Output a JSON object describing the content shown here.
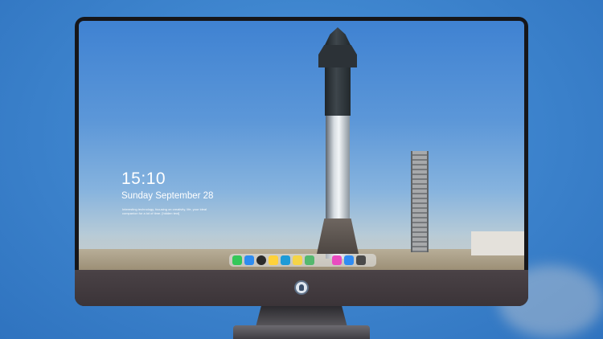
{
  "lock_screen": {
    "time": "15:10",
    "date": "Sunday September 28",
    "note": "Interesting technology, focusing on creativity, life, your ideal companion for a lot of time. [hidden text]"
  },
  "dock": {
    "items": [
      {
        "name": "messages",
        "icon": "message-icon",
        "color": "#34c759",
        "glyph": "💬"
      },
      {
        "name": "files",
        "icon": "folder-icon",
        "color": "#2e8cf0",
        "glyph": "▣"
      },
      {
        "name": "clock",
        "icon": "clock-icon",
        "color": "#2b2b2b",
        "glyph": "◷"
      },
      {
        "name": "photos",
        "icon": "photos-icon",
        "color": "#ffd23a",
        "glyph": "✿"
      },
      {
        "name": "videos",
        "icon": "clapper-icon",
        "color": "#1e9bd7",
        "glyph": "▶"
      },
      {
        "name": "notes",
        "icon": "notes-icon",
        "color": "#f5d547",
        "glyph": "≡"
      },
      {
        "name": "gallery",
        "icon": "gallery-icon",
        "color": "#54b86e",
        "glyph": "▦"
      },
      {
        "name": "music",
        "icon": "music-icon",
        "color": "#ea4cc0",
        "glyph": "♫"
      },
      {
        "name": "app-store",
        "icon": "appstore-icon",
        "color": "#2f8cf3",
        "glyph": "A"
      },
      {
        "name": "camera",
        "icon": "camera-icon",
        "color": "#4a4a4a",
        "glyph": "◉"
      }
    ]
  },
  "colors": {
    "background": "#3f86cf",
    "monitor_bezel": "#161619",
    "chin": "#4a4246"
  }
}
